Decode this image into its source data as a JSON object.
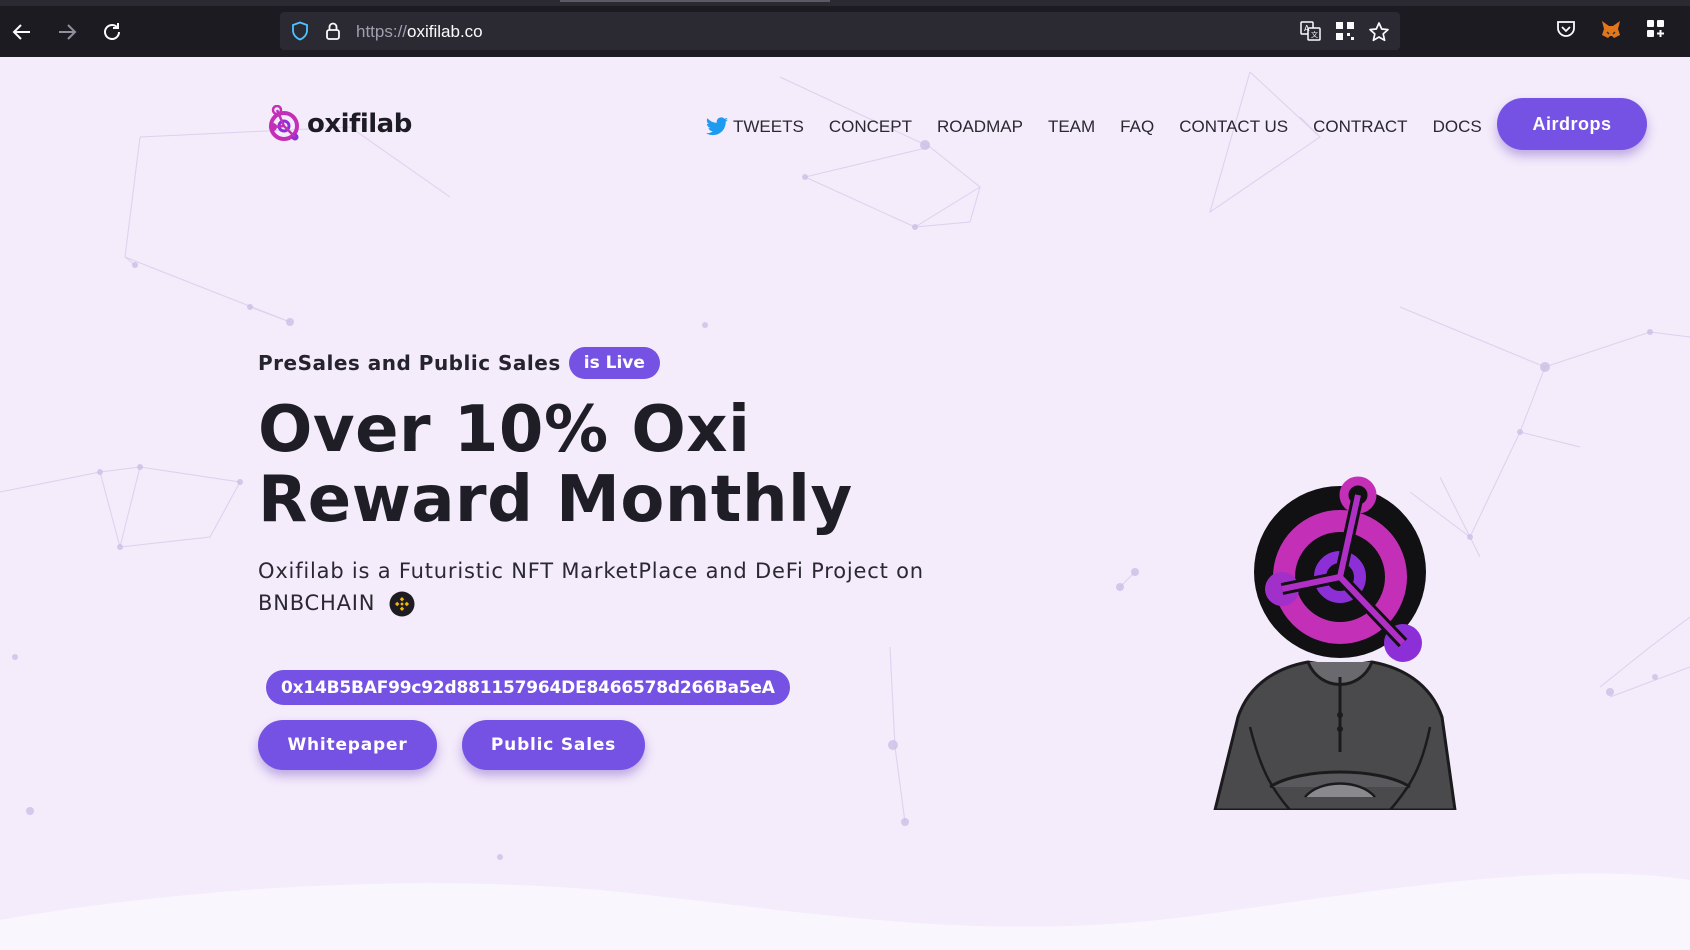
{
  "browser": {
    "url_scheme": "https://",
    "url_host": "oxifilab.co",
    "icons": {
      "back": "arrow-left-icon",
      "forward": "arrow-right-icon",
      "reload": "reload-icon",
      "shield": "shield-icon",
      "lock": "lock-icon",
      "translate": "translate-icon",
      "qr": "qr-grid-icon",
      "bookmark": "star-icon",
      "pocket": "pocket-icon",
      "metamask": "metamask-fox-icon",
      "extensions": "extensions-grid-icon"
    }
  },
  "site": {
    "logo_text": "oxifilab",
    "nav": [
      "TWEETS",
      "CONCEPT",
      "ROADMAP",
      "TEAM",
      "FAQ",
      "CONTACT US",
      "CONTRACT",
      "DOCS"
    ],
    "cta": "Airdrops"
  },
  "hero": {
    "eyebrow": "PreSales and Public Sales",
    "badge": "is Live",
    "title_line1": "Over 10% Oxi",
    "title_line2": "Reward Monthly",
    "desc_line1": "Oxifilab is a Futuristic NFT MarketPlace and DeFi Project on",
    "desc_line2": "BNBCHAIN",
    "contract": "0x14B5BAF99c92d881157964DE8466578d266Ba5eA",
    "btn_whitepaper": "Whitepaper",
    "btn_public_sales": "Public Sales"
  },
  "colors": {
    "accent": "#7552e3",
    "page_bg": "#f4ebfb",
    "text_dark": "#1f1d26",
    "browser_bg": "#1c1b22"
  }
}
